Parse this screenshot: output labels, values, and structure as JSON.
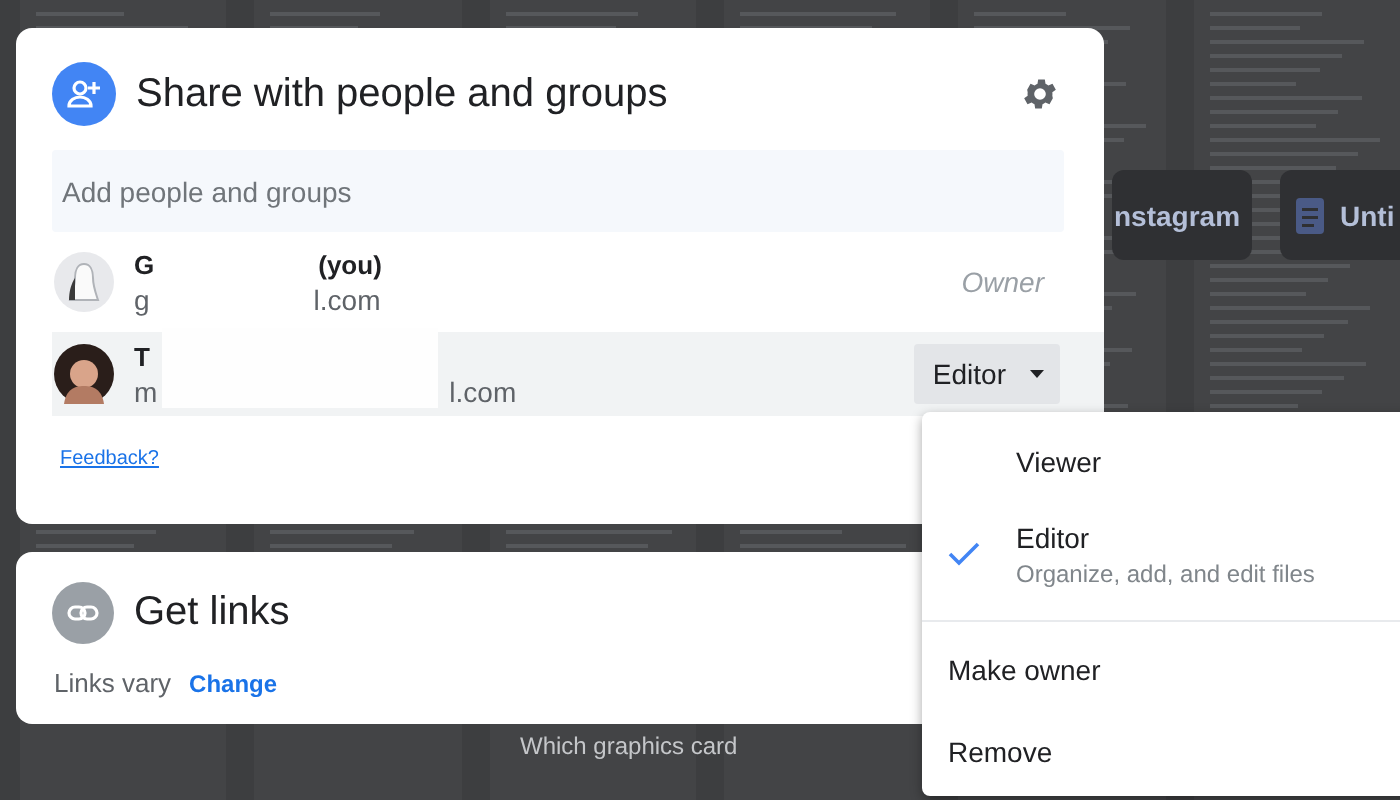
{
  "background": {
    "tiles": [
      {
        "label": "nstagram",
        "kind": "plain"
      },
      {
        "label": "Unti",
        "kind": "doc"
      }
    ],
    "caption": "Which graphics card"
  },
  "share_dialog": {
    "title": "Share with people and groups",
    "search": {
      "placeholder": "Add people and groups"
    },
    "people": [
      {
        "name_parts": [
          "G",
          "(you)"
        ],
        "email_parts": [
          "g",
          "l.com"
        ],
        "role": "Owner",
        "kind": "owner",
        "selected": false
      },
      {
        "name_parts": [
          "T"
        ],
        "email_parts": [
          "m",
          "l.com"
        ],
        "role": "Editor",
        "kind": "editable",
        "selected": true
      }
    ],
    "feedback": "Feedback?"
  },
  "links_dialog": {
    "title": "Get links",
    "status": "Links vary",
    "action": "Change"
  },
  "role_menu": {
    "items": [
      {
        "kind": "role",
        "label": "Viewer",
        "selected": false
      },
      {
        "kind": "role",
        "label": "Editor",
        "description": "Organize, add, and edit files",
        "selected": true
      },
      {
        "kind": "divider"
      },
      {
        "kind": "action",
        "label": "Make owner"
      },
      {
        "kind": "action",
        "label": "Remove"
      }
    ]
  }
}
